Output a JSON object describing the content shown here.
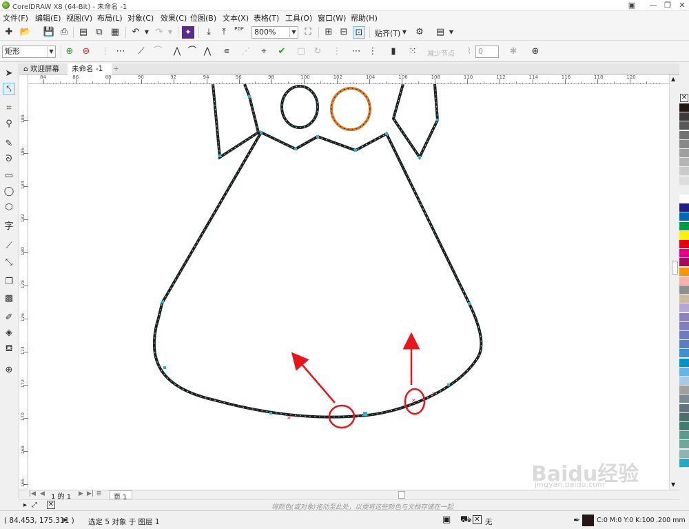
{
  "window": {
    "title": "CorelDRAW X8 (64-Bit) - 未命名 -1"
  },
  "menu": [
    "文件(F)",
    "编辑(E)",
    "视图(V)",
    "布局(L)",
    "对象(C)",
    "效果(C)",
    "位图(B)",
    "文本(X)",
    "表格(T)",
    "工具(O)",
    "窗口(W)",
    "帮助(H)"
  ],
  "toolbar": {
    "zoom": "800%",
    "snap_label": "贴齐(T)",
    "pdf_label": "PDF"
  },
  "propbar": {
    "object_type": "矩形",
    "reduce_nodes": "减少节点",
    "smooth_value": "0"
  },
  "tabs": {
    "welcome": "欢迎屏幕",
    "document": "未命名 -1",
    "add": "+"
  },
  "ruler": {
    "top": [
      "84",
      "86",
      "88",
      "90",
      "92",
      "94",
      "96",
      "98",
      "100",
      "102",
      "104",
      "106",
      "108",
      "110",
      "112",
      "114",
      "116",
      "118",
      "120"
    ],
    "left": [
      "188",
      "186",
      "184",
      "182",
      "180",
      "178",
      "176",
      "174",
      "172",
      "170",
      "168",
      "166"
    ]
  },
  "toolbox_icons": [
    "pick-icon",
    "shape-icon",
    "crop-icon",
    "zoom-icon",
    "freehand-icon",
    "artistic-media-icon",
    "rectangle-icon",
    "ellipse-icon",
    "polygon-icon",
    "text-icon",
    "parallel-dimension-icon",
    "connector-icon",
    "drop-shadow-icon",
    "transparency-icon",
    "eyedropper-icon",
    "interactive-fill-icon",
    "smart-fill-icon",
    "add-tool-icon"
  ],
  "palette": [
    "#231815",
    "#3d3a39",
    "#595757",
    "#727171",
    "#898989",
    "#9fa0a0",
    "#b5b5b6",
    "#c9caca",
    "#dcdddd",
    "#efefef",
    "#ffffff",
    "#1d2088",
    "#0068b7",
    "#009944",
    "#fff100",
    "#e60012",
    "#e4007f",
    "#a40b5d",
    "#f39800",
    "#f5b1aa",
    "#8f8f8f",
    "#c9bc9c",
    "#b3a7d1",
    "#8e82bc",
    "#7f7fbf",
    "#6d7bbf",
    "#5a7ec2",
    "#3f8fcf",
    "#0092c7",
    "#62b5e5",
    "#a7c8e6",
    "#9fa0a0",
    "#7d8a8f",
    "#61767c",
    "#4a6f6d",
    "#3e7e72",
    "#5a9b8e",
    "#73a69a",
    "#8db5b0",
    "#27a9c1"
  ],
  "page": {
    "counter": "1 的 1",
    "tab": "页 1"
  },
  "hint": "将颜色(或对象)拖动至此处，以便将这些颜色与文档存储在一起",
  "status": {
    "coords": "( 84.453, 175.311 )",
    "selection": "选定 5 对象 于 图层 1",
    "fill_label": "无",
    "outline_color": "C:0 M:0 Y:0 K:100",
    "outline_width": ".200 mm"
  },
  "colors": {
    "accent": "#7ab8e8",
    "annotation": "#e8151b",
    "nodes": "#29b6c9",
    "outline": "#1f1f1f",
    "orange_stroke": "#d77a2a"
  },
  "watermark": {
    "brand": "Baidu经验",
    "url": "jingyan.baidu.com"
  }
}
